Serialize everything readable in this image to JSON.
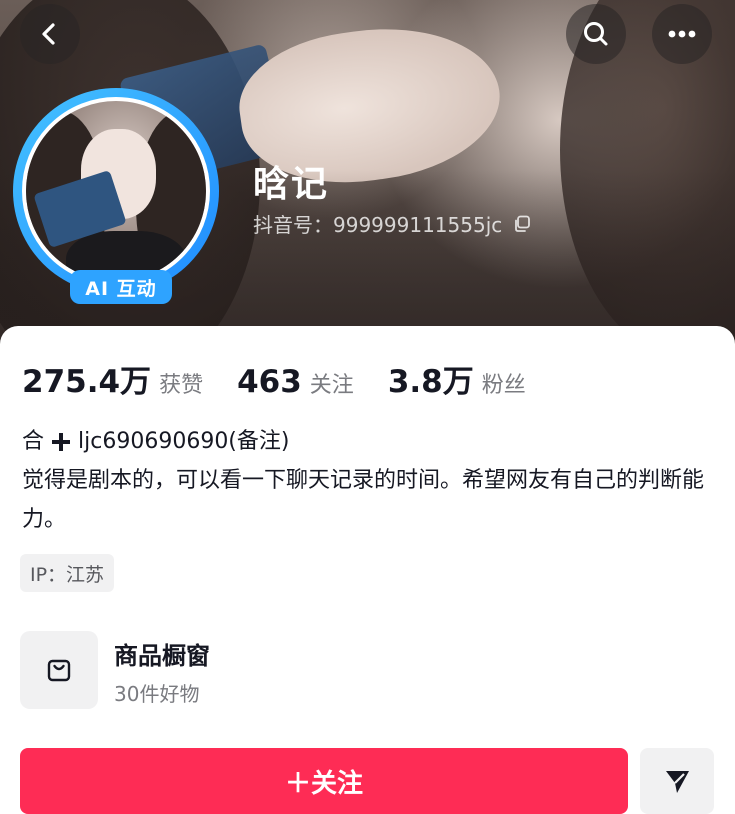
{
  "header": {
    "back_icon": "chevron-left-icon",
    "search_icon": "search-icon",
    "more_icon": "more-dots-icon"
  },
  "profile": {
    "ai_badge": "AI 互动",
    "nickname": "晗记",
    "douyin_id": "抖音号：999999111555jc",
    "copy_icon": "copy-icon"
  },
  "stats": [
    {
      "value": "275.4万",
      "label": "获赞"
    },
    {
      "value": "463",
      "label": "关注"
    },
    {
      "value": "3.8万",
      "label": "粉丝"
    }
  ],
  "bio": {
    "line1_prefix": "合",
    "line1_suffix": "ljc690690690(备注)",
    "text": "觉得是剧本的，可以看一下聊天记录的时间。希望网友有自己的判断能力。"
  },
  "ip_location": "IP：江苏",
  "shop": {
    "title": "商品橱窗",
    "subtitle": "30件好物",
    "icon": "shopping-bag-icon"
  },
  "actions": {
    "follow_label": "＋关注",
    "send_icon": "send-icon"
  },
  "colors": {
    "follow": "#fe2c55",
    "avatar_ring": "#2ea3ff",
    "secondary_text": "#7a7b80"
  }
}
